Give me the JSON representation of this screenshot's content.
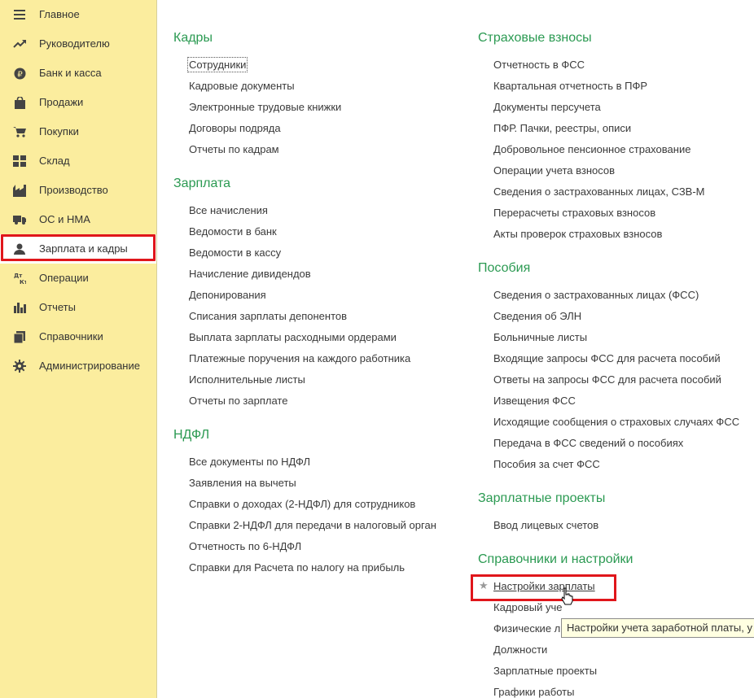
{
  "sidebar": {
    "items": [
      {
        "label": "Главное",
        "icon": "menu-icon"
      },
      {
        "label": "Руководителю",
        "icon": "trend-icon"
      },
      {
        "label": "Банк и касса",
        "icon": "ruble-icon"
      },
      {
        "label": "Продажи",
        "icon": "bag-icon"
      },
      {
        "label": "Покупки",
        "icon": "cart-icon"
      },
      {
        "label": "Склад",
        "icon": "grid-icon"
      },
      {
        "label": "Производство",
        "icon": "factory-icon"
      },
      {
        "label": "ОС и НМА",
        "icon": "truck-icon"
      },
      {
        "label": "Зарплата и кадры",
        "icon": "person-icon"
      },
      {
        "label": "Операции",
        "icon": "dt-kt-icon",
        "icon_text": "Дт Кт"
      },
      {
        "label": "Отчеты",
        "icon": "bar-chart-icon"
      },
      {
        "label": "Справочники",
        "icon": "book-icon"
      },
      {
        "label": "Администрирование",
        "icon": "gear-icon"
      }
    ],
    "active_index": 8
  },
  "sections": {
    "kadry": {
      "title": "Кадры",
      "links": [
        "Сотрудники",
        "Кадровые документы",
        "Электронные трудовые книжки",
        "Договоры подряда",
        "Отчеты по кадрам"
      ]
    },
    "zarplata": {
      "title": "Зарплата",
      "links": [
        "Все начисления",
        "Ведомости в банк",
        "Ведомости в кассу",
        "Начисление дивидендов",
        "Депонирования",
        "Списания зарплаты депонентов",
        "Выплата зарплаты расходными ордерами",
        "Платежные поручения на каждого работника",
        "Исполнительные листы",
        "Отчеты по зарплате"
      ]
    },
    "ndfl": {
      "title": "НДФЛ",
      "links": [
        "Все документы по НДФЛ",
        "Заявления на вычеты",
        "Справки о доходах (2-НДФЛ) для сотрудников",
        "Справки 2-НДФЛ для передачи в налоговый орган",
        "Отчетность по 6-НДФЛ",
        "Справки для Расчета по налогу на прибыль"
      ]
    },
    "strah": {
      "title": "Страховые взносы",
      "links": [
        "Отчетность в ФСС",
        "Квартальная отчетность в ПФР",
        "Документы персучета",
        "ПФР. Пачки, реестры, описи",
        "Добровольное пенсионное страхование",
        "Операции учета взносов",
        "Сведения о застрахованных лицах, СЗВ-М",
        "Перерасчеты страховых взносов",
        "Акты проверок страховых взносов"
      ]
    },
    "posobiya": {
      "title": "Пособия",
      "links": [
        "Сведения о застрахованных лицах (ФСС)",
        "Сведения об ЭЛН",
        "Больничные листы",
        "Входящие запросы ФСС для расчета пособий",
        "Ответы на запросы ФСС для расчета пособий",
        "Извещения ФСС",
        "Исходящие сообщения о страховых случаях ФСС",
        "Передача в ФСС сведений о пособиях",
        "Пособия за счет ФСС"
      ]
    },
    "zp_proekty": {
      "title": "Зарплатные проекты",
      "links": [
        "Ввод лицевых счетов"
      ]
    },
    "spravochniki": {
      "title": "Справочники и настройки",
      "links": [
        "Настройки зарплаты",
        "Кадровый уче",
        "Физические л",
        "Должности",
        "Зарплатные проекты",
        "Графики работы"
      ]
    }
  },
  "tooltip": "Настройки учета заработной платы, у",
  "colors": {
    "sidebar_bg": "#fbed9e",
    "section_title": "#2b9a52",
    "highlight": "#e0161b",
    "tooltip_bg": "#ffffe1"
  }
}
